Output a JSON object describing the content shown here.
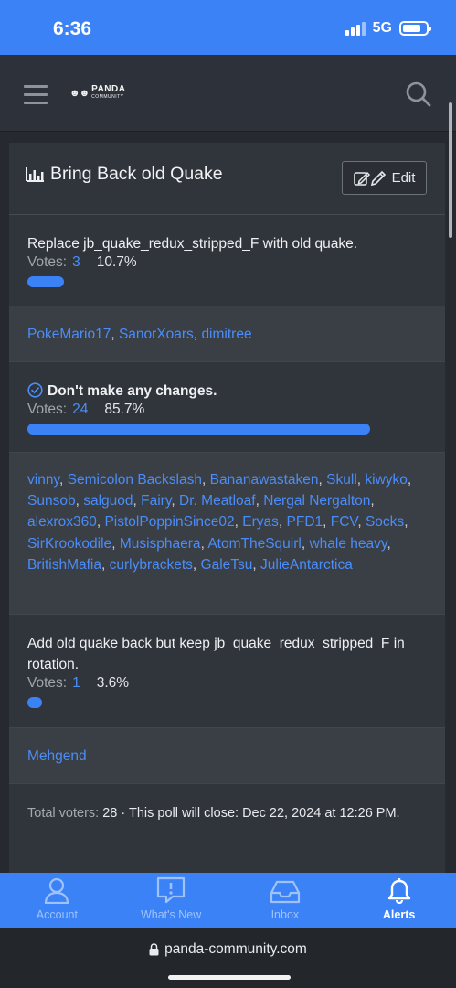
{
  "status_bar": {
    "time": "6:36",
    "network": "5G"
  },
  "header": {
    "logo_glyph": "☻☻",
    "logo_text": "PANDA",
    "logo_sub": "COMMUNITY"
  },
  "poll": {
    "title": "Bring Back old Quake",
    "edit_label": "Edit",
    "options": [
      {
        "text": "Replace jb_quake_redux_stripped_F with old quake.",
        "votes_label": "Votes:",
        "votes": "3",
        "percent": "10.7%",
        "fraction": 0.107,
        "voters": [
          "PokeMario17",
          "SanorXoars",
          "dimitree"
        ]
      },
      {
        "text": "Don't make any changes.",
        "votes_label": "Votes:",
        "votes": "24",
        "percent": "85.7%",
        "fraction": 0.857,
        "voted": true,
        "voters": [
          "vinny",
          "Semicolon Backslash",
          "Bananawastaken",
          "Skull",
          "kiwyko",
          "Sunsob",
          "salguod",
          "Fairy",
          "Dr. Meatloaf",
          "Nergal Nergalton",
          "alexrox360",
          "PistolPoppinSince02",
          "Eryas",
          "PFD1",
          "FCV",
          "Socks",
          "SirKrookodile",
          "Musisphaera",
          "AtomTheSquirl",
          "whale heavy",
          "BritishMafia",
          "curlybrackets",
          "GaleTsu",
          "JulieAntarctica"
        ]
      },
      {
        "text": "Add old quake back but keep jb_quake_redux_stripped_F in rotation.",
        "votes_label": "Votes:",
        "votes": "1",
        "percent": "3.6%",
        "fraction": 0.036,
        "voters": [
          "Mehgend"
        ]
      }
    ],
    "footer": {
      "total_label": "Total voters:",
      "total": "28",
      "close_label": "· This poll will close:",
      "close_date": "Dec 22, 2024 at 12:26 PM."
    }
  },
  "tabs": [
    {
      "label": "Account",
      "icon": "account-icon"
    },
    {
      "label": "What's New",
      "icon": "whats-new-icon"
    },
    {
      "label": "Inbox",
      "icon": "inbox-icon"
    },
    {
      "label": "Alerts",
      "icon": "bell-icon",
      "active": true
    }
  ],
  "browser": {
    "url": "panda-community.com"
  },
  "colors": {
    "accent": "#3b82f6",
    "link": "#4b8df8",
    "background": "#262a30",
    "card": "#30343b"
  }
}
